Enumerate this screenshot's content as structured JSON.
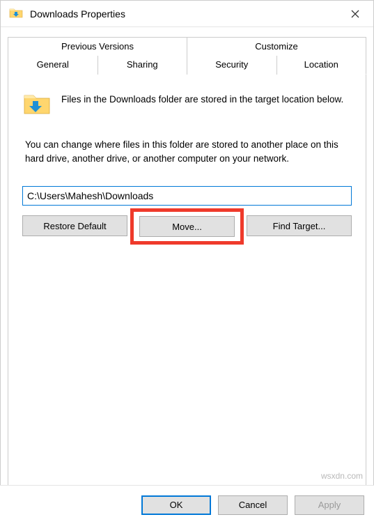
{
  "window": {
    "title": "Downloads Properties"
  },
  "tabs": {
    "row1": [
      "Previous Versions",
      "Customize"
    ],
    "row2": [
      "General",
      "Sharing",
      "Security",
      "Location"
    ],
    "active": "Location"
  },
  "content": {
    "info": "Files in the Downloads folder are stored in the target location below.",
    "desc": "You can change where files in this folder are stored to another place on this hard drive, another drive, or another computer on your network.",
    "path": "C:\\Users\\Mahesh\\Downloads",
    "buttons": {
      "restore": "Restore Default",
      "move": "Move...",
      "find": "Find Target..."
    }
  },
  "footer": {
    "ok": "OK",
    "cancel": "Cancel",
    "apply": "Apply"
  },
  "watermark": "wsxdn.com"
}
